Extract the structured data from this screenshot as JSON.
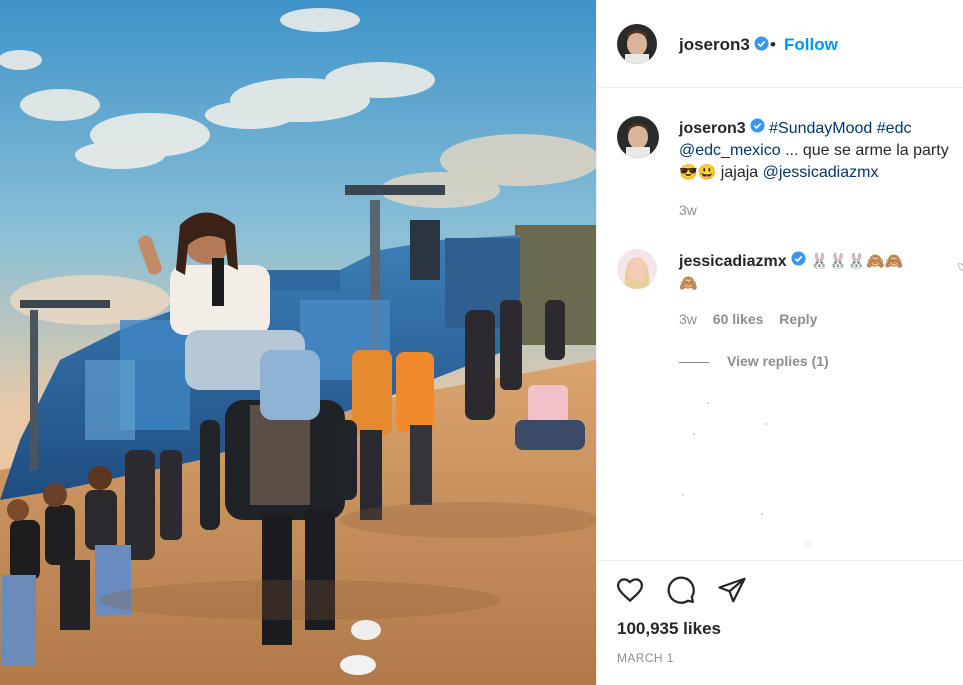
{
  "post": {
    "author": "joseron3",
    "separator": "•",
    "follow_label": "Follow",
    "photo_icon": "festival-photo"
  },
  "caption": {
    "user": "joseron3",
    "tags": [
      "#SundayMood",
      "#edc",
      "@edc_mexico"
    ],
    "text_after_mention": " ... que se arme la party",
    "emojis": "😎😃",
    "text_end": " jajaja ",
    "mention_end": "@jessicadiazmx",
    "time": "3w"
  },
  "comments": [
    {
      "user": "jessicadiazmx",
      "text": "🐰🐰🐰🙈🙈",
      "text_line2": "🙈",
      "time": "3w",
      "likes": "60 likes",
      "reply_label": "Reply",
      "view_replies": "View replies (1)"
    }
  ],
  "actions": {
    "like_icon": "heart-icon",
    "comment_icon": "comment-icon",
    "share_icon": "send-icon"
  },
  "stats": {
    "likes": "100,935 likes",
    "date": "MARCH 1"
  },
  "colors": {
    "accent": "#0095f6",
    "verified": "#3897f0",
    "muted": "#8e8e8e",
    "text": "#262626"
  }
}
